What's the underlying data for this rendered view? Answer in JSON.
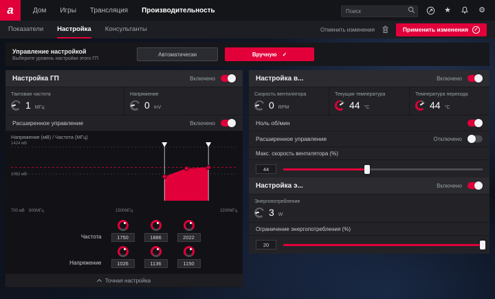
{
  "colors": {
    "accent": "#e1003a"
  },
  "topbar": {
    "logo_letter": "a",
    "nav": [
      {
        "label": "Дом"
      },
      {
        "label": "Игры"
      },
      {
        "label": "Трансляция"
      },
      {
        "label": "Производительность"
      }
    ],
    "search_placeholder": "Поиск"
  },
  "tabbar": {
    "tabs": [
      {
        "label": "Показатели"
      },
      {
        "label": "Настройка"
      },
      {
        "label": "Консультанты"
      }
    ],
    "discard_label": "Отменить изменения",
    "apply_label": "Применить изменения",
    "apply_check": "✓"
  },
  "tuning_control": {
    "title": "Управление настройкой",
    "subtitle": "Выберите уровень настройки этого ГП",
    "auto_label": "Автоматически",
    "manual_label": "Вручную",
    "manual_check": "✓"
  },
  "gpu_panel": {
    "title": "Настройка ГП",
    "state": "Включено",
    "clock": {
      "label": "Тактовая частота",
      "value": "1",
      "unit": "МГц"
    },
    "voltage": {
      "label": "Напряжение",
      "value": "0",
      "unit": "mV"
    },
    "advanced": {
      "label": "Расширенное управление",
      "state": "Включено"
    },
    "knobs": {
      "frequency": {
        "label": "Частота",
        "values": [
          "1750",
          "1886",
          "2022"
        ]
      },
      "voltage": {
        "label": "Напряжение",
        "values": [
          "1026",
          "1136",
          "1150"
        ]
      }
    },
    "footer": "Точная настройка"
  },
  "fan_panel": {
    "title": "Настройка в...",
    "state": "Включено",
    "speed": {
      "label": "Скорость вентилятора",
      "value": "0",
      "unit": "RPM"
    },
    "temp": {
      "label": "Текущая температура",
      "value": "44",
      "unit": "°C"
    },
    "junction": {
      "label": "Температура перехода",
      "value": "44",
      "unit": "°C"
    },
    "zero_rpm": {
      "label": "Ноль об/мин"
    },
    "advanced": {
      "label": "Расширенное управление",
      "state": "Отключено"
    },
    "max_speed": {
      "label": "Макс. скорость вентилятора (%)",
      "value": "44",
      "percent": 42
    }
  },
  "power_panel": {
    "title": "Настройка э...",
    "state": "Включено",
    "power": {
      "label": "Энергопотребление",
      "value": "3",
      "unit": "W"
    },
    "limit": {
      "label": "Ограничение энергопотребления (%)",
      "value": "20",
      "percent": 100
    }
  },
  "chart_data": {
    "type": "area",
    "title": "Напряжение (мВ) / Частота (МГц)",
    "x": [
      1750,
      1886,
      2022
    ],
    "y": [
      1026,
      1136,
      1150
    ],
    "xlim": [
      800,
      2200
    ],
    "ylim": [
      700,
      1424
    ],
    "x_tick_labels": [
      "800МГц",
      "1500МГц",
      "2200МГц"
    ],
    "y_tick_labels": [
      "1424 мВ",
      "1062 мВ",
      "700 мВ"
    ],
    "gridlines_mv": [
      1424,
      1062
    ],
    "limit_line_mv": 1150
  }
}
